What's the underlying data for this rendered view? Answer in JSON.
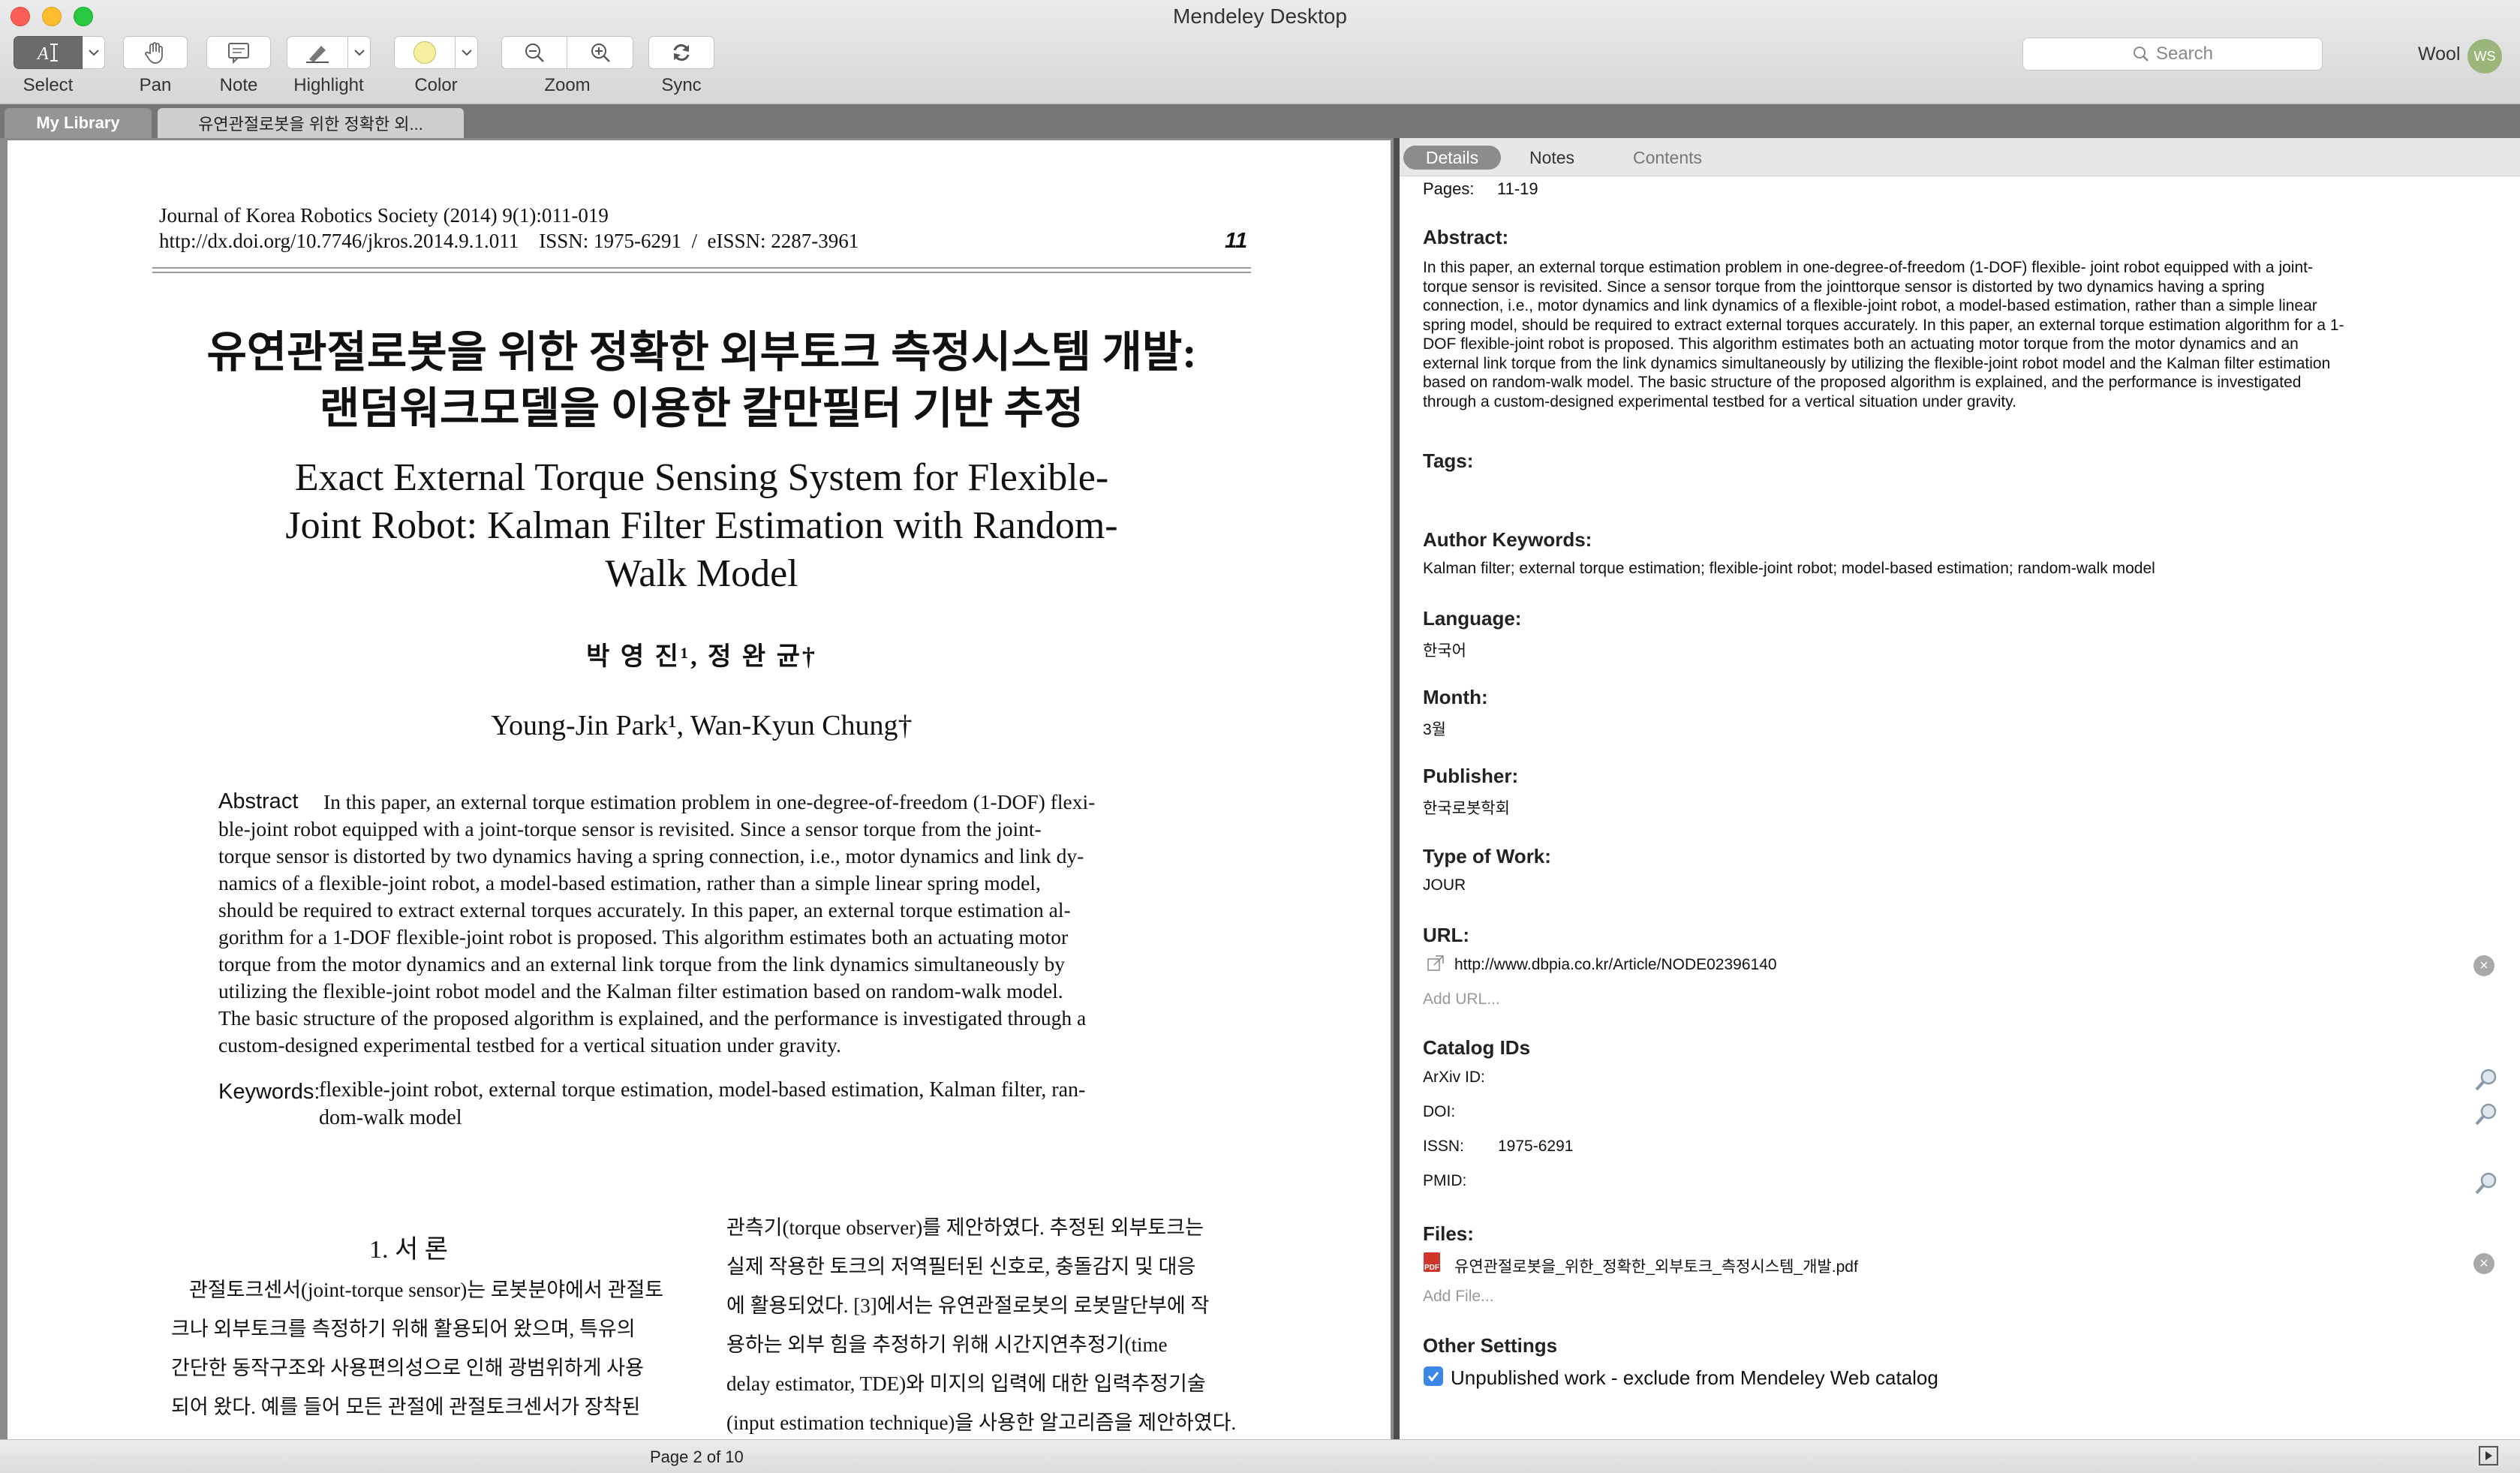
{
  "window": {
    "title": "Mendeley Desktop"
  },
  "toolbar": {
    "select": "Select",
    "pan": "Pan",
    "note": "Note",
    "highlight": "Highlight",
    "color": "Color",
    "zoom": "Zoom",
    "sync": "Sync",
    "search_placeholder": "Search",
    "user_name": "Wool",
    "user_initials": "WS",
    "highlight_color": "#f7efa0"
  },
  "tabs": {
    "library": "My Library",
    "document": "유연관절로봇을 위한 정확한 외..."
  },
  "pdf": {
    "journal_line": "Journal of Korea Robotics Society (2014) 9(1):011-019",
    "doi_line": "http://dx.doi.org/10.7746/jkros.2014.9.1.011    ISSN: 1975-6291  /  eISSN: 2287-3961",
    "page_number": "11",
    "title_ko_1": "유연관절로봇을 위한 정확한 외부토크 측정시스템 개발:",
    "title_ko_2": "랜덤워크모델을 이용한 칼만필터 기반 추정",
    "title_en_1": "Exact External Torque Sensing System for Flexible-",
    "title_en_2": "Joint Robot: Kalman Filter Estimation with Random-",
    "title_en_3": "Walk Model",
    "authors_ko": "박 영 진¹, 정 완 균†",
    "authors_en": "Young-Jin Park¹, Wan-Kyun Chung†",
    "abstract_label": "Abstract",
    "abstract_lines": [
      "In this paper, an external torque estimation problem in one-degree-of-freedom (1-DOF) flexi-",
      "ble-joint robot equipped with a joint-torque sensor is revisited. Since a sensor torque from the joint-",
      "torque sensor is distorted by two dynamics having a spring connection, i.e., motor dynamics and link dy-",
      "namics of a flexible-joint robot, a model-based estimation, rather than a simple linear spring model,",
      "should be required to extract external torques accurately. In this paper, an external torque estimation al-",
      "gorithm for a 1-DOF flexible-joint robot is proposed. This algorithm estimates both an actuating motor",
      "torque from the motor dynamics and an external link torque from the link dynamics simultaneously by",
      "utilizing the flexible-joint robot model and the Kalman filter estimation based on random-walk model.",
      "The basic structure of the proposed algorithm is explained, and the performance is investigated through a",
      "custom-designed experimental testbed for a vertical situation under gravity."
    ],
    "keywords_label": "Keywords:",
    "keywords_1": "flexible-joint robot, external torque estimation, model-based estimation, Kalman filter, ran-",
    "keywords_2": "dom-walk model",
    "section_title": "1. 서  론",
    "left_col": [
      "관절토크센서(joint-torque sensor)는 로봇분야에서 관절토",
      "크나 외부토크를 측정하기 위해 활용되어 왔으며, 특유의",
      "간단한 동작구조와 사용편의성으로 인해 광범위하게 사용",
      "되어 왔다. 예를 들어 모든 관절에 관절토크센서가 장착된"
    ],
    "right_col": [
      "관측기(torque observer)를 제안하였다. 추정된 외부토크는",
      "실제 작용한 토크의 저역필터된 신호로, 충돌감지 및 대응",
      "에 활용되었다. [3]에서는 유연관절로봇의 로봇말단부에 작",
      "용하는 외부 힘을 추정하기 위해 시간지연추정기(time",
      "delay estimator, TDE)와 미지의 입력에 대한 입력추정기술",
      "(input estimation technique)을 사용한 알고리즘을 제안하였다."
    ]
  },
  "details": {
    "tabs": [
      "Details",
      "Notes",
      "Contents"
    ],
    "pages_label": "Pages:",
    "pages_value": "11-19",
    "abstract_label": "Abstract:",
    "abstract_lines": [
      "In this paper, an external torque estimation problem in one-degree-of-freedom (1-DOF) flexible- joint robot equipped with a joint-",
      "torque sensor is revisited. Since a sensor torque from the jointtorque sensor is distorted by two dynamics having a spring",
      "connection, i.e., motor dynamics and link dynamics of a flexible-joint robot, a model-based estimation, rather than a simple linear",
      "spring model, should be required to extract external torques accurately. In this paper, an external torque estimation algorithm for a 1-",
      "DOF flexible-joint robot is proposed. This algorithm estimates both an actuating motor torque from the motor dynamics and an",
      "external link torque from the link dynamics simultaneously by utilizing the flexible-joint robot model and the Kalman filter estimation",
      "based on random-walk model. The basic structure of the proposed algorithm is explained, and the performance is investigated",
      "through a custom-designed experimental testbed for a vertical situation under gravity."
    ],
    "tags_label": "Tags:",
    "author_keywords_label": "Author Keywords:",
    "author_keywords_value": "Kalman filter; external torque estimation; flexible-joint robot; model-based estimation; random-walk model",
    "language_label": "Language:",
    "language_value": "한국어",
    "month_label": "Month:",
    "month_value": "3월",
    "publisher_label": "Publisher:",
    "publisher_value": "한국로봇학회",
    "type_label": "Type of Work:",
    "type_value": "JOUR",
    "url_label": "URL:",
    "url_value": "http://www.dbpia.co.kr/Article/NODE02396140",
    "add_url": "Add URL...",
    "catalog_label": "Catalog IDs",
    "arxiv_label": "ArXiv ID:",
    "doi_label": "DOI:",
    "issn_label": "ISSN:",
    "issn_value": "1975-6291",
    "pmid_label": "PMID:",
    "files_label": "Files:",
    "file_name": "유연관절로봇을_위한_정확한_외부토크_측정시스템_개발.pdf",
    "add_file": "Add File...",
    "other_label": "Other Settings",
    "unpublished_label": "Unpublished work - exclude from Mendeley Web catalog"
  },
  "status": {
    "page_indicator": "Page 2 of 10"
  }
}
